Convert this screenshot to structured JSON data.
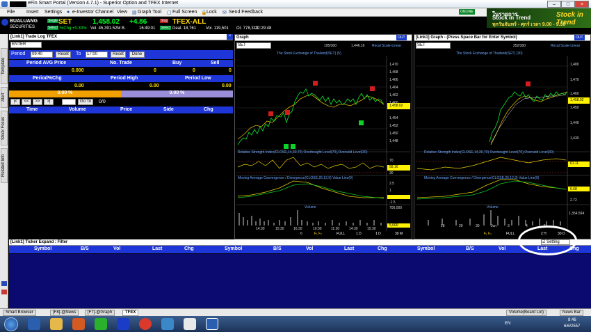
{
  "window": {
    "title": "eFin Smart Portal (Version 4.7.1) - Superior Option and TFEX Internet",
    "controls": [
      "–",
      "□",
      "×"
    ]
  },
  "menu": {
    "items": [
      "File",
      "Insert",
      "Settings",
      "e-Investor Channel",
      "View",
      "Graph Tool",
      "Full Screen",
      "Lock",
      "Send Feedback"
    ],
    "online_badge": "ONLINE"
  },
  "ad": {
    "line1": "ในรายการ",
    "line2": "Stock in Trend",
    "line3": "ทุกวันจันทร์ - ศุกร์ เวลา 9.00 - 9.30",
    "logo": "Stock in Trend"
  },
  "broker": {
    "name": "BUALUANG",
    "sub": "SECURITIES"
  },
  "quote": {
    "symbol": "SET",
    "price": "1,458.02",
    "change": "+4.86",
    "pct_chg": "%Chg,+0.33%",
    "vol": "Vol. 45,391.52M B.",
    "time": "16:49:01",
    "chip1": "Single",
    "chip2": "Select",
    "chip3": "Stop",
    "chip4": "Single",
    "chip5": "Select",
    "tfex_symbol": "TFEX-ALL",
    "deal": "Deal. 18,761",
    "tfex_vol": "Vol. 119,501",
    "oi": "OI. 778,313",
    "tfex_time": "22:29:48"
  },
  "left_tabs": [
    "Template",
    "Alert",
    "Stock Focus",
    "Related Info"
  ],
  "tradelog": {
    "header": "[Link1] Trade Log TFEX",
    "search_value": "ENTER",
    "period_label": "Period",
    "period_from": "09:40",
    "reset_label": "Reset",
    "to_label": "To",
    "period_to": "17:00",
    "done_label": "Done",
    "summary_headers": [
      "Period AVG Price",
      "No. Trade",
      "Buy",
      "Sell"
    ],
    "summary_values": [
      "0.000",
      "0",
      "0",
      "0"
    ],
    "period_headers": [
      "Period%Chg",
      "Period High",
      "Period Low"
    ],
    "period_values": [
      "0.00",
      "0.00",
      "0.00"
    ],
    "pct1": "0.00 %",
    "pct2": "0.00 %",
    "nav_buttons": [
      "|<",
      "<<",
      ">>",
      ">|"
    ],
    "goto_label": "Go To",
    "page": "0/0",
    "columns": [
      "Time",
      "Volume",
      "Price",
      "Side",
      "Chg"
    ]
  },
  "chart1": {
    "header": "Graph",
    "symbol": "SET",
    "counter": "195/300",
    "price_label": "1,446.16",
    "scale_label": "Recal Scale-Linear",
    "title": "The Stock Exchange of Thailand(SET) (5)",
    "y_ticks": [
      "1,470",
      "1,468",
      "1,466",
      "1,464",
      "1,462",
      "1,460",
      "1,458",
      "1,456",
      "1,454",
      "1,452",
      "1,450",
      "1,448",
      "1,446"
    ],
    "current": "1,458.02",
    "rsi_label": "Relative Strength Index(CLOSE,14,30,70) Overbought Level(70),Oversold Level(30)",
    "rsi_ticks": [
      "90",
      "70",
      "50",
      "30",
      "10"
    ],
    "rsi_val": "58.16",
    "macd_label": "Moving Average Convergence / Divergence(CLOSE,26,12,9) Value Line(0)",
    "macd_ticks": [
      "2.5",
      "1.5",
      "1",
      "0.5",
      "0",
      "-0.5",
      "-1.5"
    ],
    "vol_label": "Volume",
    "vol_ticks": [
      "700,000",
      "5,000"
    ],
    "x_ticks": [
      "14:30",
      "15:30",
      "16:30",
      "10:30",
      "11:30",
      "14:30",
      "15:30"
    ],
    "x_day": "6",
    "toolbar": [
      "FULL",
      "1 D",
      "1 D",
      "30 M"
    ]
  },
  "chart2": {
    "header": "[Link1] Graph - (Press Space Bar for Enter Symbol)",
    "symbol": "SET",
    "counter": "252/300",
    "scale_label": "Recal Scale-Linear",
    "title": "The Stock Exchange of Thailand(SET) (30)",
    "y_ticks": [
      "1,480",
      "1,470",
      "1,460",
      "1,450",
      "1,440",
      "1,430"
    ],
    "current": "1,458.02",
    "rsi_label": "Relative Strength Index(CLOSE,14,30,70) Overbought Level(70),Oversold Level(30)",
    "rsi_val": "61.11",
    "macd_label": "Moving Average Convergence / Divergence(CLOSE,26,12,9) Value Line(0)",
    "macd_vals": [
      "6.68",
      "2.72"
    ],
    "vol_label": "Volume",
    "vol_val": "1,354,594",
    "x_ticks": [
      "28",
      "29",
      "30",
      "Jun",
      "3",
      "4",
      "5"
    ],
    "toolbar": [
      "FULL",
      "2 H",
      "30 D"
    ]
  },
  "ticker": {
    "header": "[Link1] Ticker Expand : Filter",
    "setting_label": "Setting",
    "columns": [
      "Symbol",
      "B/S",
      "Vol",
      "Last",
      "Chg",
      "Symbol",
      "B/S",
      "Vol",
      "Last",
      "Chg",
      "Symbol",
      "B/S",
      "Vol",
      "Last",
      "Chg"
    ]
  },
  "bottom_tabs": [
    "Smart Browser",
    "[F8]-@News",
    "[F7]-@Graph",
    "TFEX"
  ],
  "bottom_right": {
    "board": "Volume(Board Lot)",
    "news": "News Bar"
  },
  "taskbar": {
    "lang": "EN",
    "time": "8:46",
    "date": "6/6/2557"
  }
}
